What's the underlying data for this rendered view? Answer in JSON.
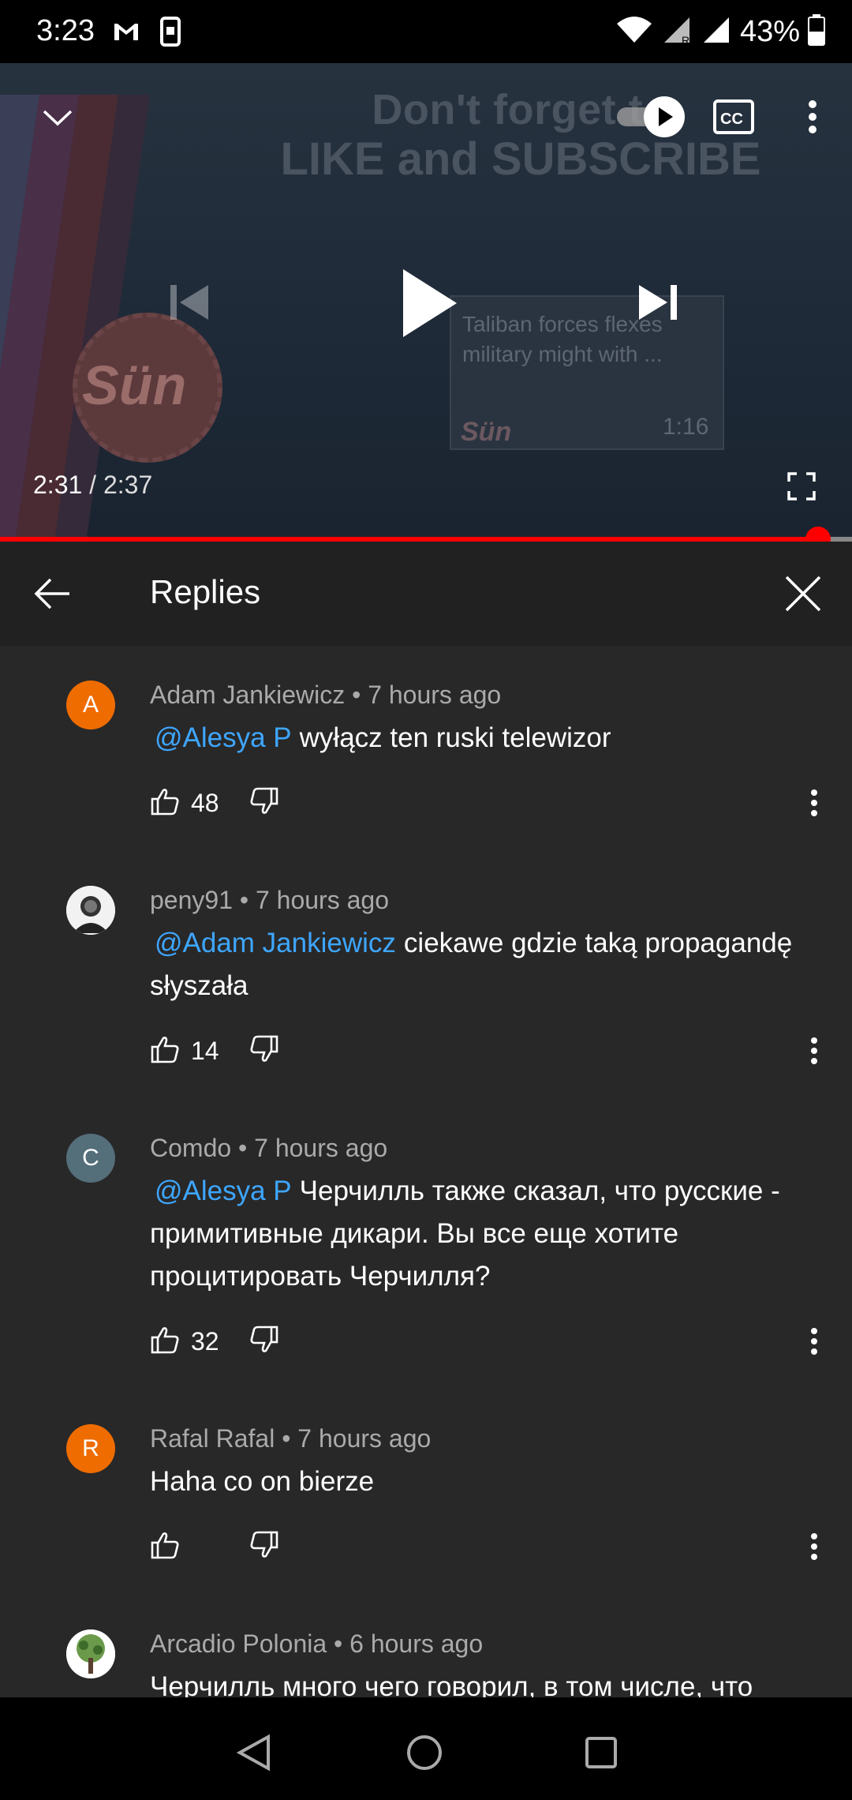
{
  "status_bar": {
    "time": "3:23",
    "battery": "43%",
    "icons": [
      "gmail-icon",
      "phone-screen-icon",
      "wifi-icon",
      "signal-roaming-icon",
      "signal-icon",
      "battery-icon"
    ]
  },
  "player": {
    "headline_line1": "Don't forget to",
    "headline_line2": "LIKE and SUBSCRIBE",
    "logo_text": "Sün",
    "next_video_title": "Taliban forces flexes military might with ...",
    "next_video_duration": "1:16",
    "next_video_logo": "Sün",
    "current_time": "2:31",
    "separator": " / ",
    "duration": "2:37",
    "progress": 0.96,
    "icons": [
      "collapse-icon",
      "autoplay-toggle-icon",
      "captions-icon",
      "more-icon",
      "previous-icon",
      "play-icon",
      "next-icon",
      "fullscreen-icon"
    ]
  },
  "replies": {
    "title": "Replies",
    "comments": [
      {
        "avatar_letter": "A",
        "avatar_color": "#ef6c00",
        "author": "Adam Jankiewicz",
        "time": "7 hours ago",
        "mention": "@Alesya P",
        "text": "wyłącz ten ruski telewizor",
        "likes": "48"
      },
      {
        "avatar_letter": "",
        "avatar_color": "#f2f2f2",
        "author": "peny91",
        "time": "7 hours ago",
        "mention": "@Adam Jankiewicz",
        "text": "ciekawe gdzie taką propagandę słyszała",
        "likes": "14"
      },
      {
        "avatar_letter": "C",
        "avatar_color": "#546e7a",
        "author": "Comdo",
        "time": "7 hours ago",
        "mention": "@Alesya P",
        "text": "Черчилль также сказал, что русские - примитивные дикари. Вы все еще хотите процитировать Черчилля?",
        "likes": "32"
      },
      {
        "avatar_letter": "R",
        "avatar_color": "#ef6c00",
        "author": "Rafal Rafal",
        "time": "7 hours ago",
        "mention": "",
        "text": "Haha co on bierze",
        "likes": ""
      },
      {
        "avatar_letter": "",
        "avatar_color": "#ffffff",
        "author": "Arcadio Polonia",
        "time": "6 hours ago",
        "mention": "",
        "text": "Черчилль много чего говорил, в том числе, что",
        "likes": ""
      }
    ],
    "bullet": " • "
  }
}
